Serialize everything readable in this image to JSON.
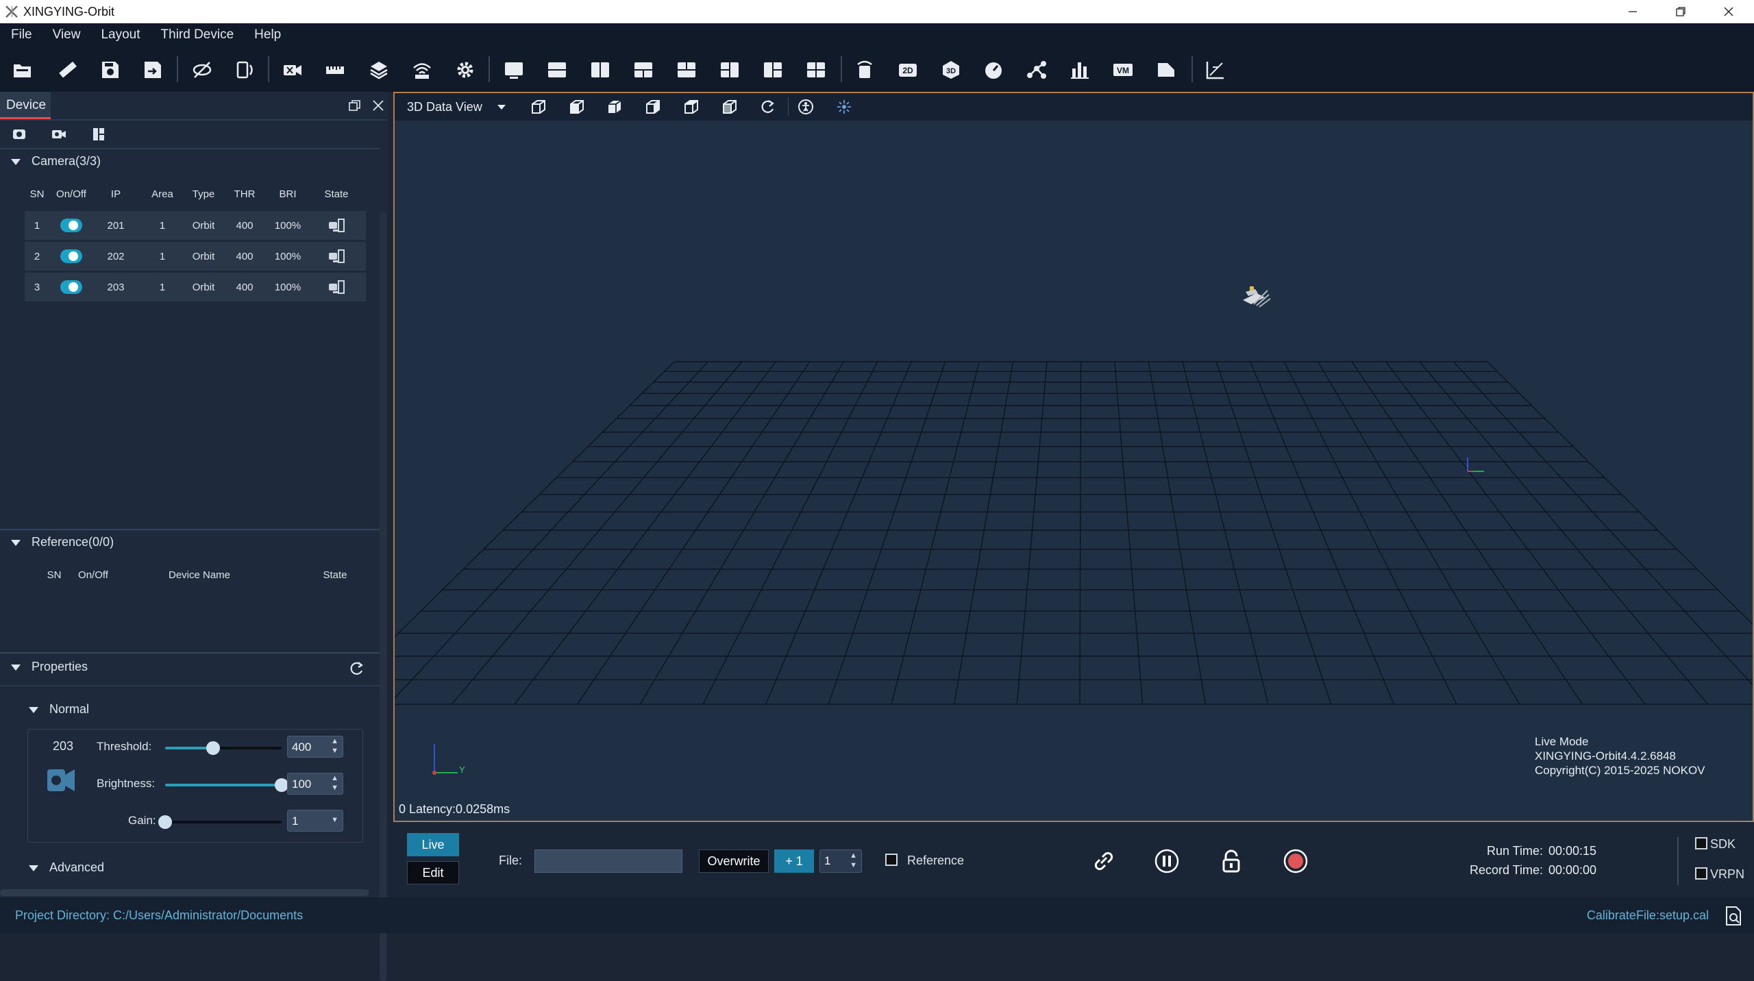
{
  "window": {
    "title": "XINGYING-Orbit"
  },
  "menu": [
    "File",
    "View",
    "Layout",
    "Third Device",
    "Help"
  ],
  "toolbar_icons": [
    "open-folder-icon",
    "ruler-icon",
    "save-icon",
    "save-as-icon",
    "hide-icon",
    "device-icon",
    "video-icon",
    "measure-icon",
    "layers-icon",
    "wifi-icon",
    "settings-icon",
    "layout-single-icon",
    "layout-split-h-icon",
    "layout-split-v-icon",
    "layout-three-icon",
    "layout-top-icon",
    "layout-left-icon",
    "layout-right-icon",
    "layout-four-icon",
    "rotate-screen-icon",
    "2d-icon",
    "3d-icon",
    "speedometer-icon",
    "skeleton-icon",
    "bar-chart-icon",
    "vm-icon",
    "document-icon",
    "axis-icon"
  ],
  "left_panel": {
    "tab": "Device",
    "camera_section": {
      "title": "Camera(3/3)",
      "headers": [
        "SN",
        "On/Off",
        "IP",
        "Area",
        "Type",
        "THR",
        "BRI",
        "State"
      ],
      "rows": [
        {
          "sn": "1",
          "ip": "201",
          "area": "1",
          "type": "Orbit",
          "thr": "400",
          "bri": "100%"
        },
        {
          "sn": "2",
          "ip": "202",
          "area": "1",
          "type": "Orbit",
          "thr": "400",
          "bri": "100%"
        },
        {
          "sn": "3",
          "ip": "203",
          "area": "1",
          "type": "Orbit",
          "thr": "400",
          "bri": "100%"
        }
      ]
    },
    "reference_section": {
      "title": "Reference(0/0)",
      "headers": [
        "SN",
        "On/Off",
        "Device Name",
        "State"
      ]
    },
    "properties": {
      "title": "Properties",
      "normal_title": "Normal",
      "camera_id": "203",
      "threshold_label": "Threshold:",
      "threshold_value": "400",
      "threshold_level": 0.41,
      "brightness_label": "Brightness:",
      "brightness_value": "100",
      "brightness_level": 1.0,
      "gain_label": "Gain:",
      "gain_value": "1",
      "gain_level": 0.0,
      "advanced_title": "Advanced"
    }
  },
  "viewport": {
    "view_name": "3D Data View",
    "latency": "0 Latency:0.0258ms",
    "mode": "Live Mode",
    "version": "XINGYING-Orbit4.4.2.6848",
    "copyright": "Copyright(C) 2015-2025 NOKOV",
    "axis_label_y": "Y"
  },
  "bottom": {
    "live_label": "Live",
    "edit_label": "Edit",
    "file_label": "File:",
    "file_value": "",
    "overwrite_label": "Overwrite",
    "plus_label": "+ 1",
    "count_value": "1",
    "reference_label": "Reference",
    "run_time_label": "Run Time:",
    "run_time_value": "00:00:15",
    "record_time_label": "Record Time:",
    "record_time_value": "00:00:00",
    "sdk_label": "SDK",
    "vrpn_label": "VRPN"
  },
  "status": {
    "project_dir": "Project Directory:   C:/Users/Administrator/Documents",
    "calibrate_file": "CalibrateFile:setup.cal"
  },
  "colors": {
    "accent": "#19a3c9",
    "record": "#e05555",
    "viewport_border": "#b07c4d"
  }
}
